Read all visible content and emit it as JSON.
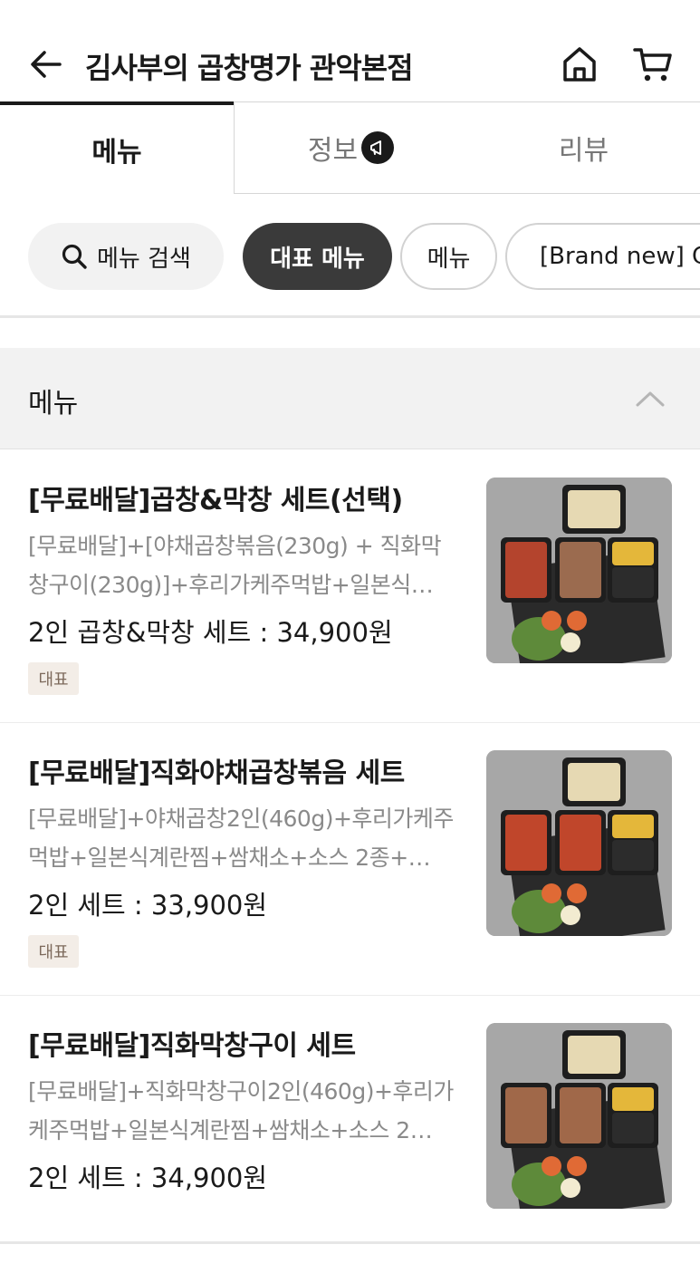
{
  "header": {
    "title": "김사부의 곱창명가 관악본점",
    "back_icon": "arrow-left-icon",
    "home_icon": "home-icon",
    "cart_icon": "cart-icon"
  },
  "tabs": [
    {
      "label": "메뉴",
      "active": true
    },
    {
      "label": "정보",
      "active": false,
      "icon": "megaphone-icon"
    },
    {
      "label": "리뷰",
      "active": false
    }
  ],
  "chips": {
    "search_label": "메뉴 검색",
    "items": [
      {
        "label": "대표 메뉴",
        "selected": true
      },
      {
        "label": "메뉴",
        "selected": false
      },
      {
        "label": "[Brand new] G",
        "selected": false
      }
    ]
  },
  "section": {
    "title": "메뉴",
    "collapse_icon": "chevron-up-icon"
  },
  "menu_items": [
    {
      "name": "[무료배달]곱창&막창 세트(선택)",
      "description": "[무료배달]+[야채곱창볶음(230g) + 직화막창구이(230g)]+후리가케주먹밥+일본식…",
      "price": "2인 곱창&막창 세트 : 34,900원",
      "badge": "대표"
    },
    {
      "name": "[무료배달]직화야채곱창볶음 세트",
      "description": "[무료배달]+야채곱창2인(460g)+후리가케주먹밥+일본식계란찜+쌈채소+소스 2종+…",
      "price": "2인 세트 : 33,900원",
      "badge": "대표"
    },
    {
      "name": "[무료배달]직화막창구이 세트",
      "description": "[무료배달]+직화막창구이2인(460g)+후리가케주먹밥+일본식계란찜+쌈채소+소스 2…",
      "price": "2인 세트 : 34,900원",
      "badge": ""
    }
  ],
  "colors": {
    "active_chip_bg": "#3a3a3a",
    "badge_bg": "#f3ede7",
    "badge_text": "#7d6a5c",
    "secondary_text": "#8a8a8a"
  }
}
